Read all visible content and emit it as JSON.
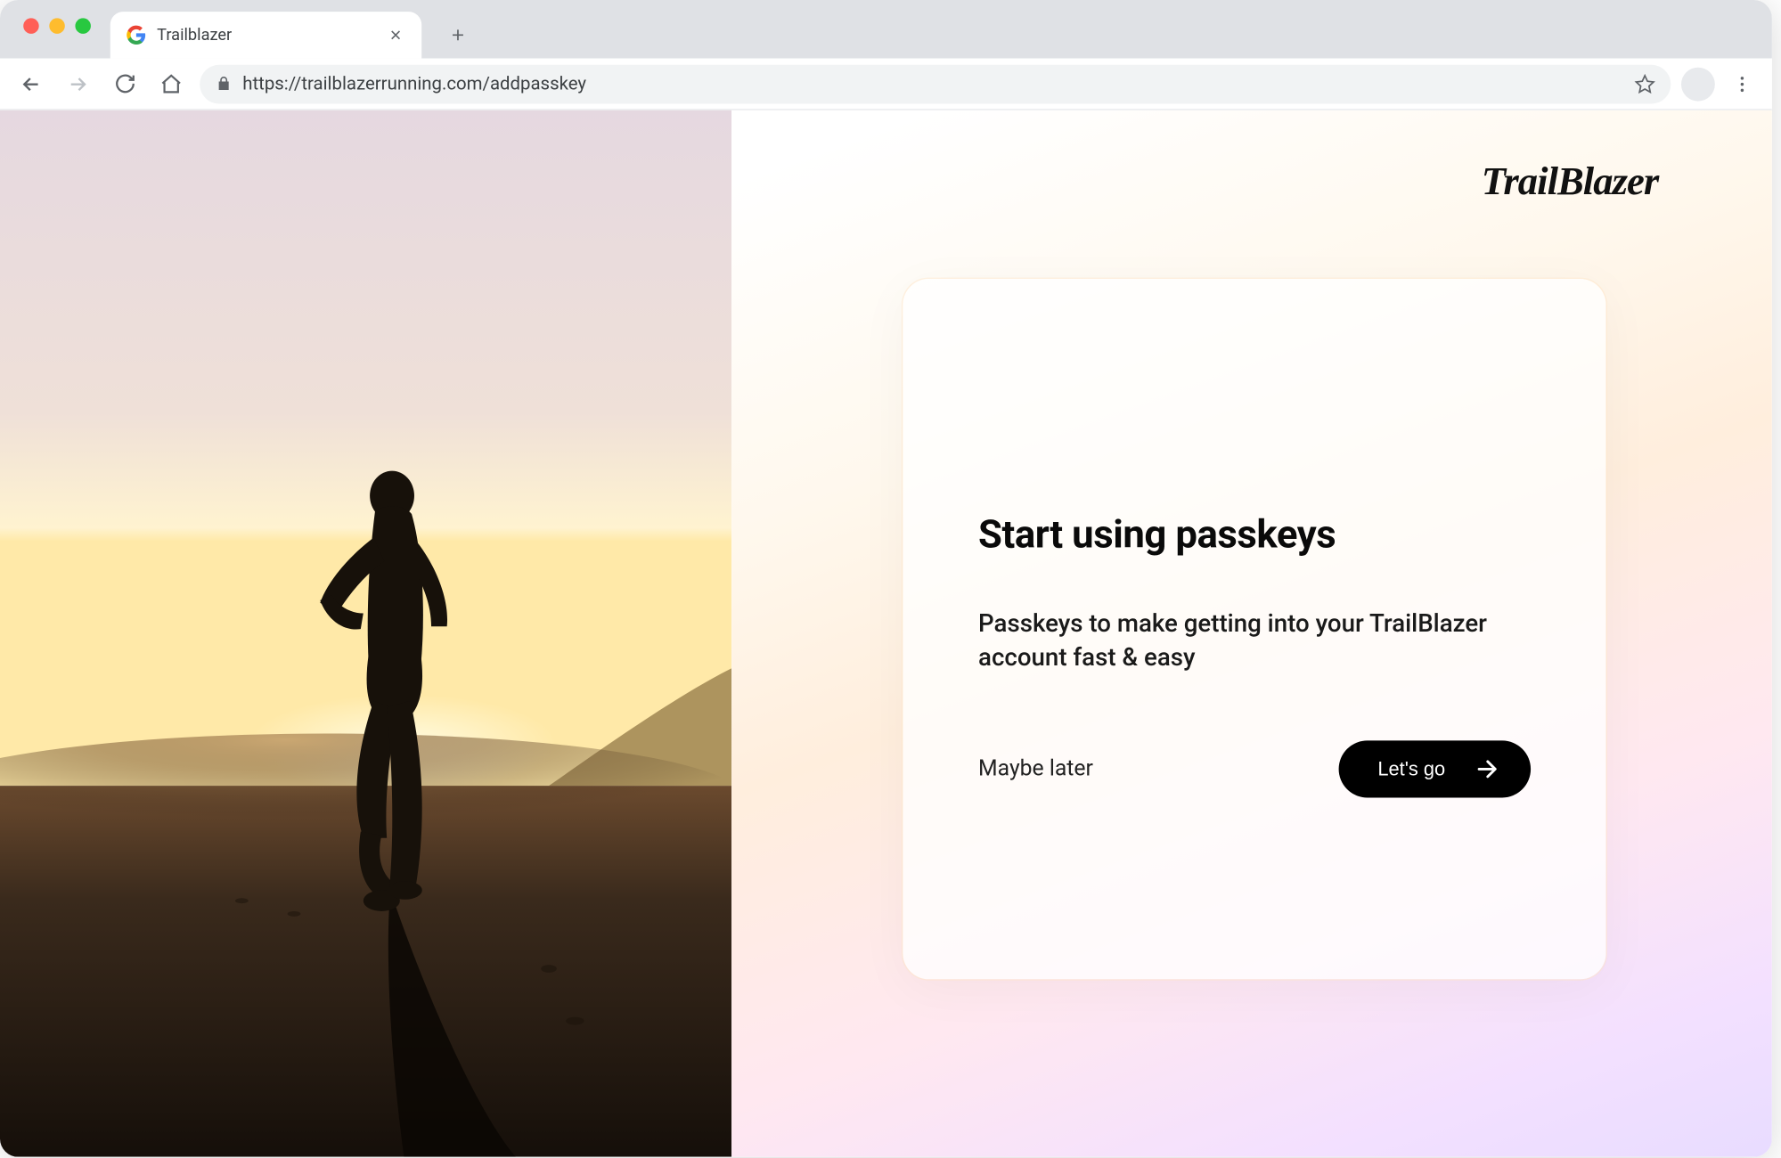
{
  "browser": {
    "tab_title": "Trailblazer",
    "url": "https://trailblazerrunning.com/addpasskey"
  },
  "brand": {
    "name": "TrailBlazer"
  },
  "card": {
    "title": "Start using passkeys",
    "description": "Passkeys to make getting into your TrailBlazer account fast & easy",
    "secondary_action": "Maybe later",
    "primary_action": "Let's go"
  }
}
